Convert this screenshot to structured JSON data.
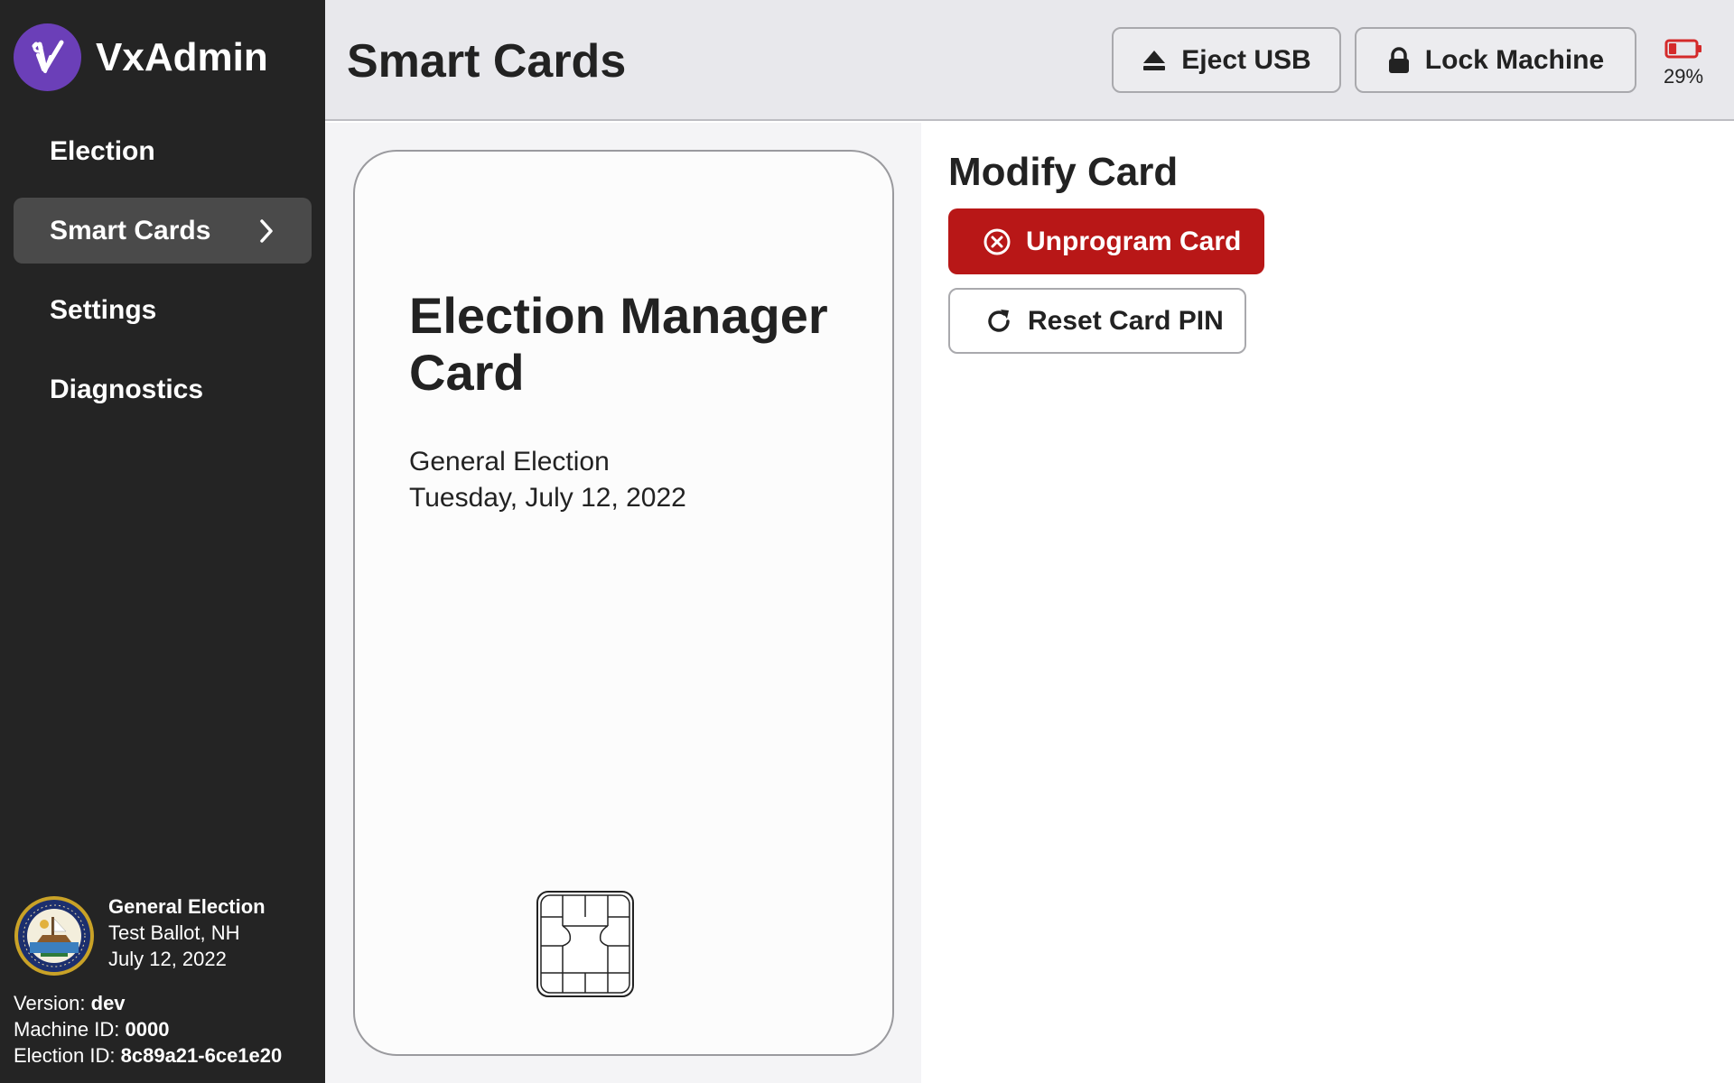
{
  "app": {
    "name": "VxAdmin"
  },
  "sidebar": {
    "items": [
      {
        "label": "Election"
      },
      {
        "label": "Smart Cards"
      },
      {
        "label": "Settings"
      },
      {
        "label": "Diagnostics"
      }
    ]
  },
  "election": {
    "title": "General Election",
    "location": "Test Ballot, NH",
    "date": "July 12, 2022"
  },
  "meta": {
    "version_label": "Version:",
    "version": "dev",
    "machine_id_label": "Machine ID:",
    "machine_id": "0000",
    "election_id_label": "Election ID:",
    "election_id": "8c89a21-6ce1e20"
  },
  "header": {
    "title": "Smart Cards",
    "eject_label": "Eject USB",
    "lock_label": "Lock Machine",
    "battery_percent": "29%",
    "battery_level": 0.29
  },
  "card": {
    "title": "Election Manager Card",
    "election_name": "General Election",
    "election_date": "Tuesday, July 12, 2022"
  },
  "modify": {
    "title": "Modify Card",
    "unprogram_label": "Unprogram Card",
    "reset_pin_label": "Reset Card PIN"
  },
  "colors": {
    "brand_purple": "#6b3fb8",
    "danger_red": "#b81717",
    "sidebar_bg": "#242424",
    "battery_low": "#d42a2a"
  },
  "icons": {
    "logo": "vx-logo-icon",
    "chevron": "chevron-right-icon",
    "eject": "eject-icon",
    "lock": "lock-icon",
    "battery": "battery-low-icon",
    "unprogram": "circle-x-icon",
    "reset": "refresh-icon",
    "chip": "smart-card-chip-icon",
    "seal": "nh-state-seal-icon"
  }
}
